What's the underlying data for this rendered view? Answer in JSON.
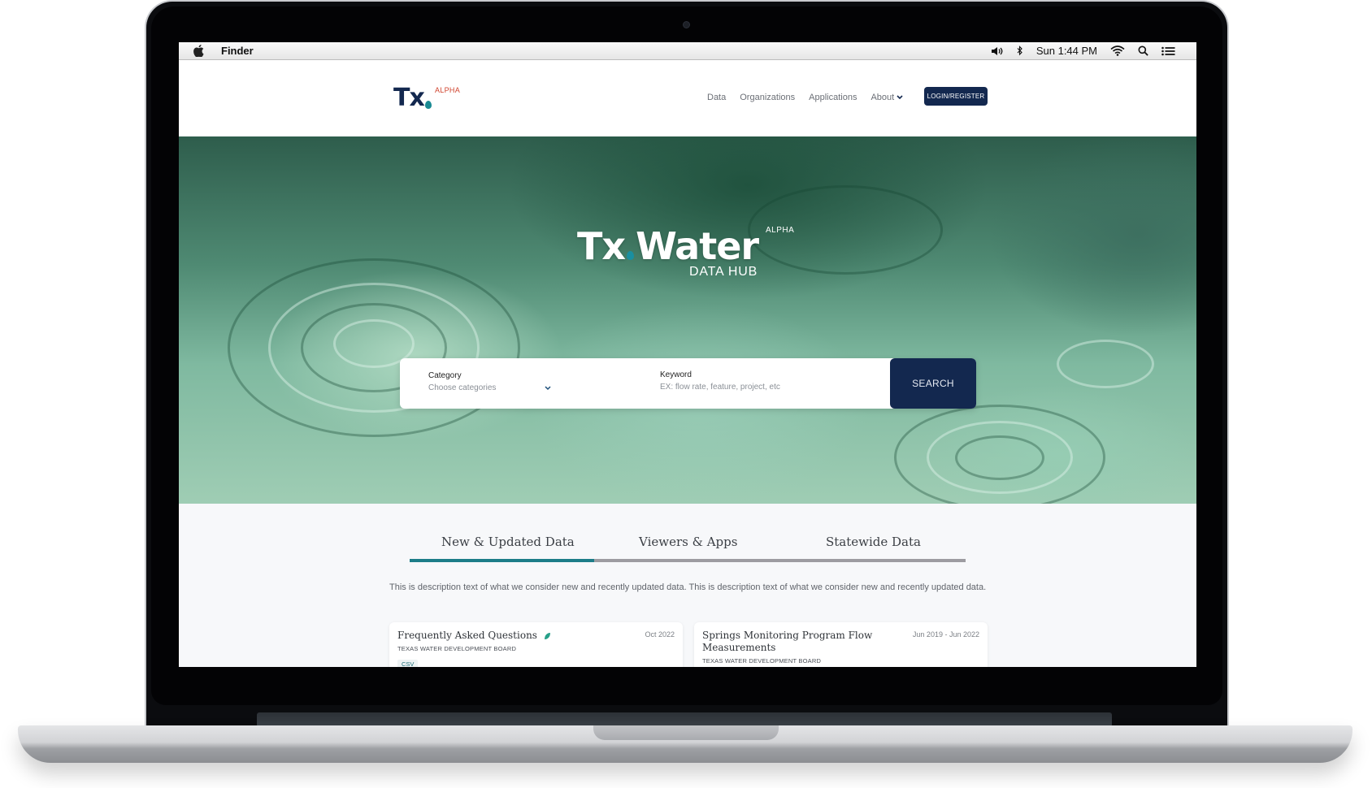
{
  "menubar": {
    "app_name": "Finder",
    "clock": "Sun 1:44 PM",
    "icons": [
      "apple-logo",
      "volume-icon",
      "bluetooth-icon",
      "wifi-icon",
      "spotlight-search-icon",
      "notification-list-icon"
    ]
  },
  "site": {
    "logo_text": "Tx",
    "logo_badge": "ALPHA",
    "nav": [
      {
        "label": "Data"
      },
      {
        "label": "Organizations"
      },
      {
        "label": "Applications"
      },
      {
        "label": "About"
      }
    ],
    "login_label": "LOGIN/REGISTER"
  },
  "hero": {
    "title_left": "Tx",
    "title_right": "Water",
    "badge": "ALPHA",
    "subtitle": "DATA HUB",
    "search": {
      "category_label": "Category",
      "category_value": "Choose categories",
      "keyword_label": "Keyword",
      "keyword_placeholder": "EX: flow rate, feature, project, etc",
      "button_label": "SEARCH"
    }
  },
  "tabs": [
    {
      "label": "New & Updated Data",
      "active": true
    },
    {
      "label": "Viewers & Apps",
      "active": false
    },
    {
      "label": "Statewide Data",
      "active": false
    }
  ],
  "description": "This is description text of what we consider new and recently updated data. This is description text of what we consider new and recently updated data.",
  "cards": [
    {
      "title": "Frequently Asked Questions",
      "org": "TEXAS WATER DEVELOPMENT BOARD",
      "date": "Oct 2022",
      "tag": "CSV",
      "icon": "leaf-icon"
    },
    {
      "title": "Springs Monitoring Program Flow Measurements",
      "org": "TEXAS WATER DEVELOPMENT BOARD",
      "date": "Jun 2019 - Jun 2022"
    }
  ],
  "colors": {
    "brand_navy": "#13284f",
    "accent_teal": "#1c7d88",
    "alpha_red": "#d0432d"
  }
}
